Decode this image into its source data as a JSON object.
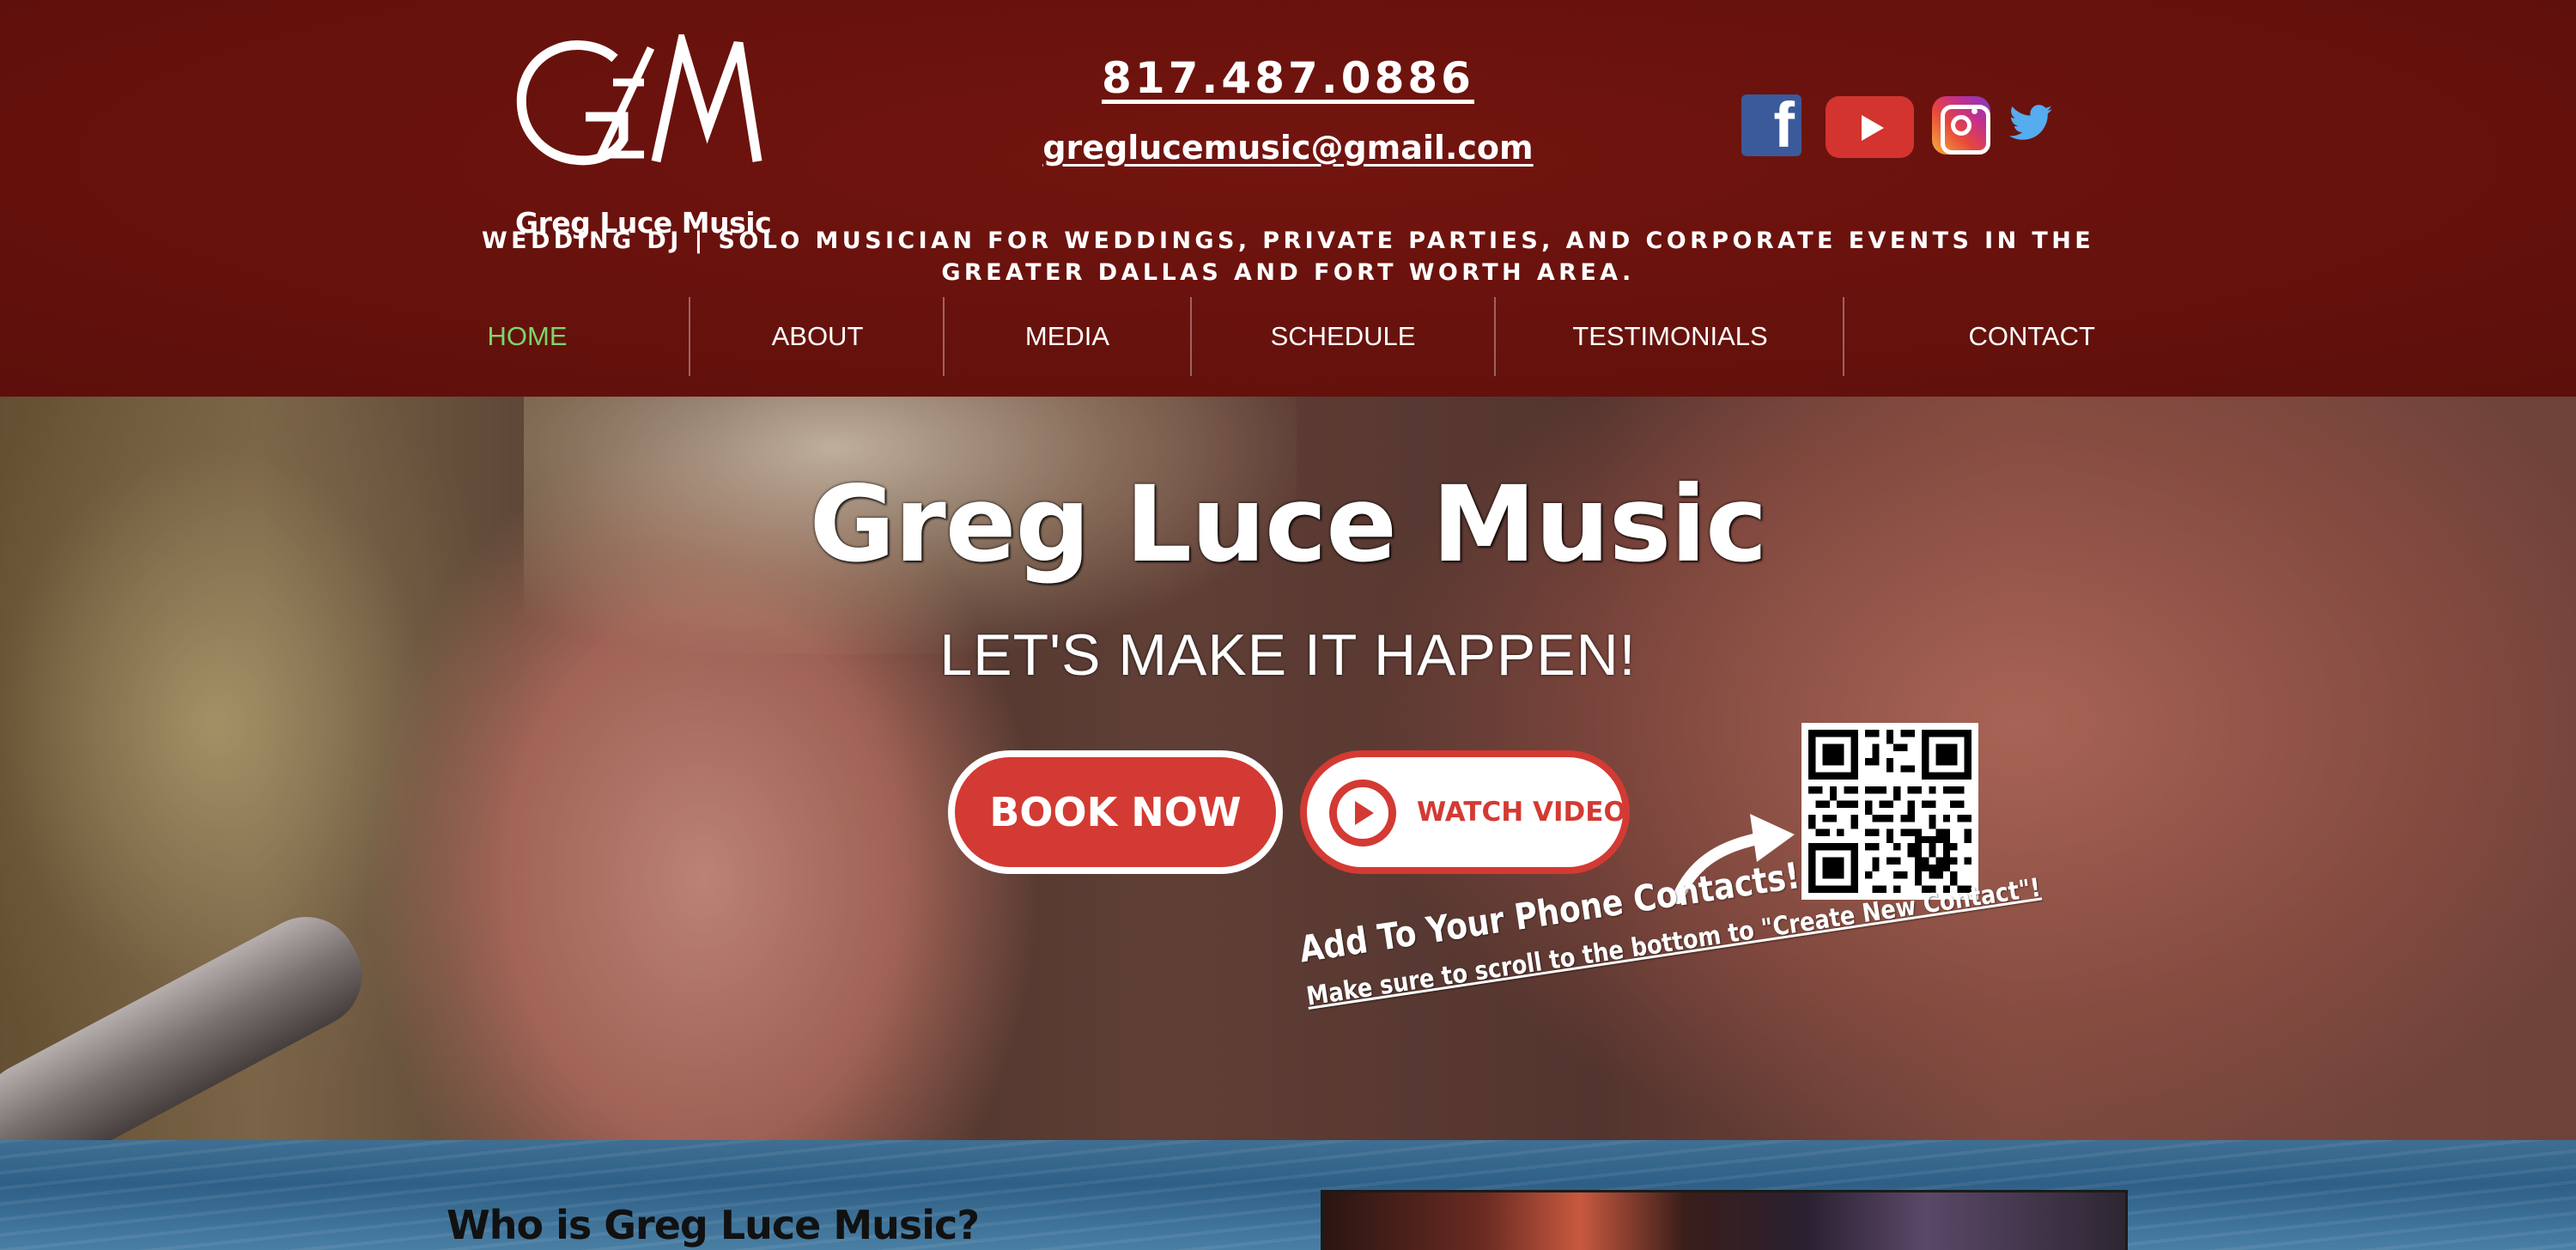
{
  "brand": {
    "logo_mark": "GLM",
    "name": "Greg Luce Music"
  },
  "contact": {
    "phone": "817.487.0886",
    "email": "greglucemusic@gmail.com"
  },
  "social": [
    {
      "name": "facebook-icon",
      "glyph": "f",
      "color": "#3b5a9a"
    },
    {
      "name": "youtube-icon",
      "color": "#d3342f"
    },
    {
      "name": "instagram-icon"
    },
    {
      "name": "twitter-icon",
      "color": "#55acee"
    }
  ],
  "tagline": "WEDDING DJ | SOLO MUSICIAN FOR WEDDINGS, PRIVATE PARTIES, AND CORPORATE EVENTS IN THE GREATER DALLAS AND FORT WORTH AREA.",
  "nav": {
    "items": [
      {
        "label": "HOME",
        "active": true
      },
      {
        "label": "ABOUT"
      },
      {
        "label": "MEDIA"
      },
      {
        "label": "SCHEDULE"
      },
      {
        "label": "TESTIMONIALS"
      },
      {
        "label": "CONTACT"
      }
    ]
  },
  "hero": {
    "title": "Greg Luce Music",
    "subtitle": "LET'S MAKE IT HAPPEN!",
    "book_button": "BOOK NOW",
    "watch_button": "WATCH VIDEO",
    "contact_heading": "Add To Your Phone Contacts!",
    "contact_note": "Make sure to scroll to the bottom to \"Create New Contact\"!"
  },
  "about": {
    "title": "Who is Greg Luce Music?"
  },
  "colors": {
    "header_bg": "#6a120e",
    "accent_red": "#d33a33",
    "nav_active": "#7bd66a",
    "text": "#ffffff"
  }
}
